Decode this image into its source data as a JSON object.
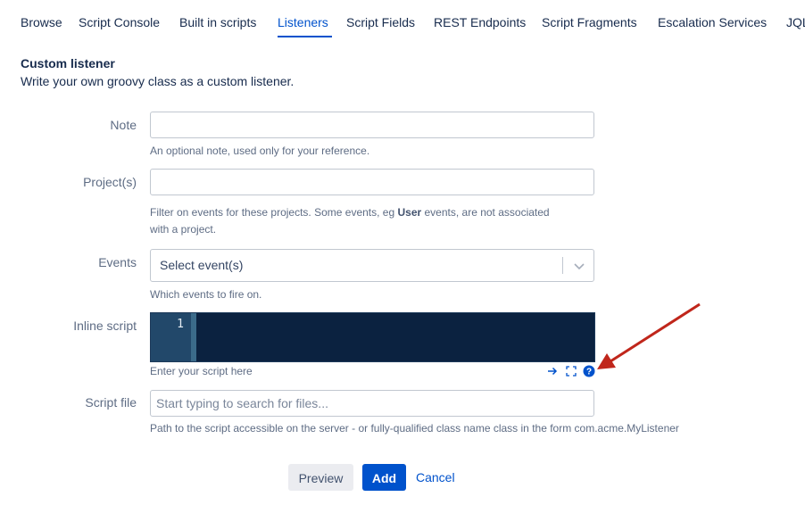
{
  "tabs": [
    {
      "label": "Browse"
    },
    {
      "label": "Script Console"
    },
    {
      "label": "Built in scripts"
    },
    {
      "label": "Listeners"
    },
    {
      "label": "Script Fields"
    },
    {
      "label": "REST Endpoints"
    },
    {
      "label": "Script Fragments"
    },
    {
      "label": "Escalation Services"
    },
    {
      "label": "JQL"
    }
  ],
  "active_tab": "Listeners",
  "section": {
    "title": "Custom listener",
    "description": "Write your own groovy class as a custom listener."
  },
  "form": {
    "note": {
      "label": "Note",
      "value": "",
      "help": "An optional note, used only for your reference."
    },
    "projects": {
      "label": "Project(s)",
      "value": "",
      "help_pre": "Filter on events for these projects. Some events, eg ",
      "help_bold": "User",
      "help_post": " events, are not associated",
      "help_line2": "with a project."
    },
    "events": {
      "label": "Events",
      "placeholder": "Select event(s)",
      "help": "Which events to fire on."
    },
    "inline_script": {
      "label": "Inline script",
      "line_number": "1",
      "help": "Enter your script here"
    },
    "script_file": {
      "label": "Script file",
      "placeholder": "Start typing to search for files...",
      "help": "Path to the script accessible on the server - or fully-qualified class name class in the form com.acme.MyListener"
    }
  },
  "editor_tools": [
    "arrow-right-icon",
    "fullscreen-icon",
    "help-icon"
  ],
  "actions": {
    "preview": "Preview",
    "add": "Add",
    "cancel": "Cancel"
  },
  "colors": {
    "accent": "#0052cc",
    "editor_bg": "#0b2240",
    "annotation_arrow": "#c0261b"
  }
}
